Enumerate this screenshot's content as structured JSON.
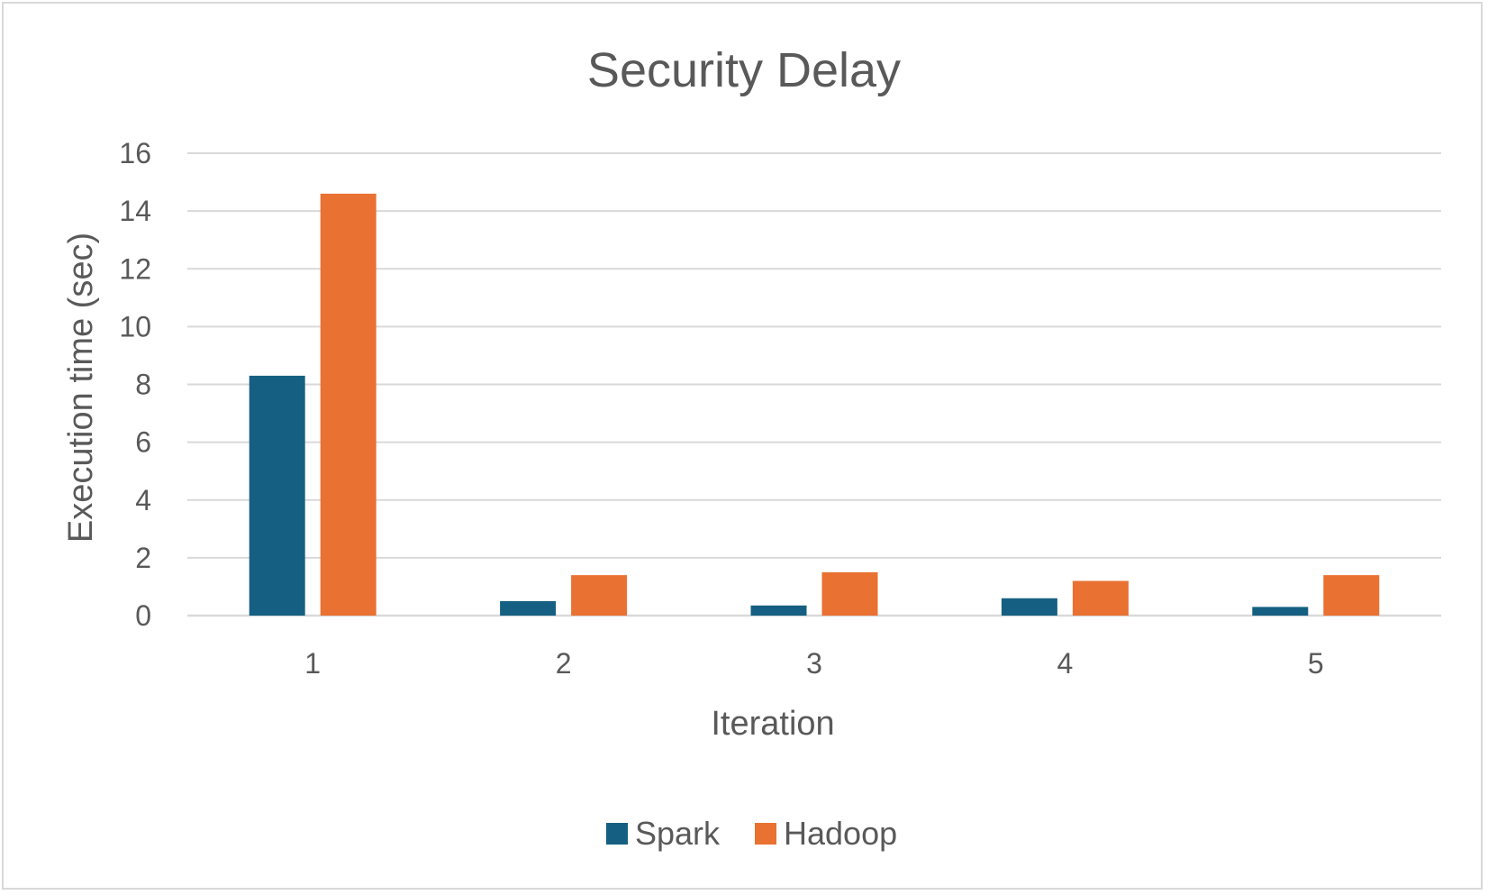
{
  "chart_data": {
    "type": "bar",
    "title": "Security Delay",
    "xlabel": "Iteration",
    "ylabel": "Execution time (sec)",
    "categories": [
      "1",
      "2",
      "3",
      "4",
      "5"
    ],
    "series": [
      {
        "name": "Spark",
        "values": [
          8.3,
          0.5,
          0.35,
          0.6,
          0.3
        ],
        "color": "#156082"
      },
      {
        "name": "Hadoop",
        "values": [
          14.6,
          1.4,
          1.5,
          1.2,
          1.4
        ],
        "color": "#E97132"
      }
    ],
    "ylim": [
      0,
      16
    ],
    "yticks": [
      "0",
      "2",
      "4",
      "6",
      "8",
      "10",
      "12",
      "14",
      "16"
    ],
    "grid": true,
    "legend_position": "bottom",
    "gridline_color": "#d9d9d9"
  }
}
